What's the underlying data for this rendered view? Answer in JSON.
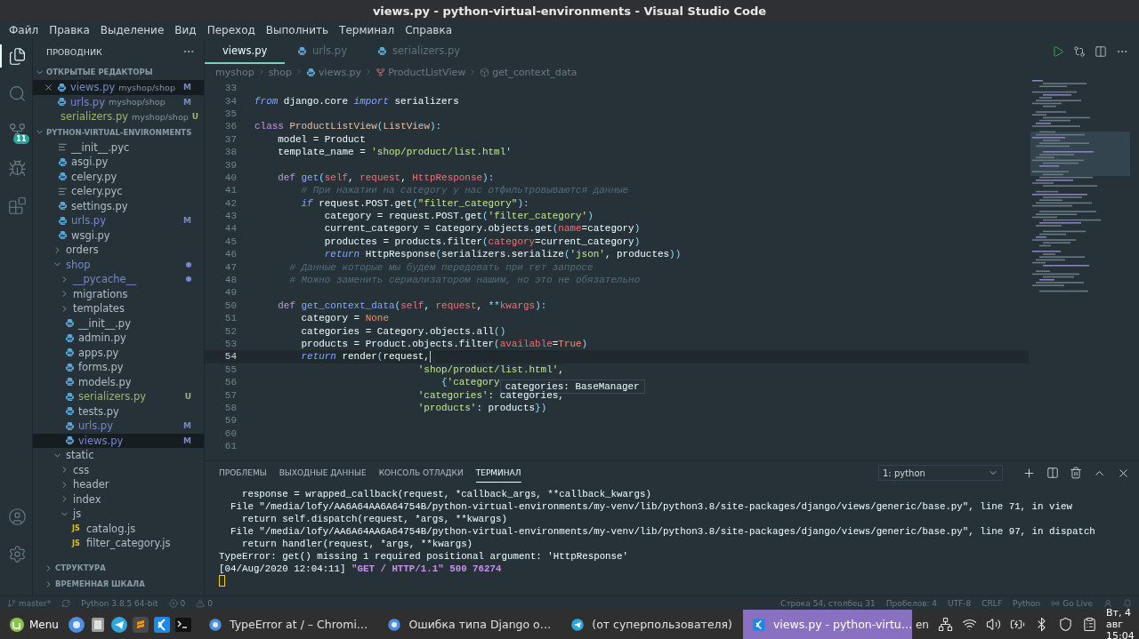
{
  "window": {
    "title": "views.py - python-virtual-environments - Visual Studio Code"
  },
  "menu": [
    "Файл",
    "Правка",
    "Выделение",
    "Вид",
    "Переход",
    "Выполнить",
    "Терминал",
    "Справка"
  ],
  "activity_bar": {
    "items": [
      {
        "kind": "explorer",
        "selected": true
      },
      {
        "kind": "search",
        "selected": false
      },
      {
        "kind": "scm",
        "selected": false,
        "badge": "11"
      },
      {
        "kind": "debug",
        "selected": false
      },
      {
        "kind": "extensions",
        "selected": false
      }
    ],
    "bottom": [
      {
        "kind": "account"
      },
      {
        "kind": "settings"
      }
    ]
  },
  "sidebar": {
    "title": "ПРОВОДНИК",
    "open_editors": {
      "title": "ОТКРЫТЫЕ РЕДАКТОРЫ",
      "expanded": true,
      "items": [
        {
          "name": "views.py",
          "path": "myshop/shop",
          "badge": "M",
          "color": "#7986cb",
          "selected": true
        },
        {
          "name": "urls.py",
          "path": "myshop/shop",
          "badge": "M",
          "color": "#7986cb",
          "selected": false
        },
        {
          "name": "serializers.py",
          "path": "myshop/shop",
          "badge": "U",
          "color": "#9cb46e",
          "selected": false
        }
      ]
    },
    "folder": {
      "title": "PYTHON-VIRTUAL-ENVIRONMENTS",
      "expanded": true,
      "tree": [
        {
          "name": "__init__.pyc",
          "kind": "compiled",
          "selected": false
        },
        {
          "name": "asgi.py",
          "kind": "python",
          "selected": false
        },
        {
          "name": "celery.py",
          "kind": "python",
          "selected": false
        },
        {
          "name": "celery.pyc",
          "kind": "compiled",
          "selected": false
        },
        {
          "name": "settings.py",
          "kind": "python",
          "selected": false
        },
        {
          "name": "urls.py",
          "kind": "python",
          "color": "#7986cb",
          "badge": "M",
          "selected": false
        },
        {
          "name": "wsgi.py",
          "kind": "python",
          "selected": false
        },
        {
          "name": "orders",
          "kind": "folder",
          "expanded": false,
          "selected": false
        },
        {
          "name": "shop",
          "kind": "folder",
          "expanded": true,
          "color": "#7986cb",
          "selected": false,
          "children": [
            {
              "name": "__pycache__",
              "kind": "folder",
              "expanded": false,
              "color": "#7986cb",
              "selected": false
            },
            {
              "name": "migrations",
              "kind": "folder",
              "expanded": false,
              "selected": false
            },
            {
              "name": "templates",
              "kind": "folder",
              "expanded": false,
              "selected": false
            },
            {
              "name": "__init__.py",
              "kind": "python",
              "selected": false
            },
            {
              "name": "admin.py",
              "kind": "python",
              "selected": false
            },
            {
              "name": "apps.py",
              "kind": "python",
              "selected": false
            },
            {
              "name": "forms.py",
              "kind": "python",
              "selected": false
            },
            {
              "name": "models.py",
              "kind": "python",
              "selected": false
            },
            {
              "name": "serializers.py",
              "kind": "python",
              "color": "#9cb46e",
              "badge": "U",
              "selected": false
            },
            {
              "name": "tests.py",
              "kind": "python",
              "selected": false
            },
            {
              "name": "urls.py",
              "kind": "python",
              "color": "#7986cb",
              "badge": "M",
              "selected": false
            },
            {
              "name": "views.py",
              "kind": "python",
              "color": "#7986cb",
              "badge": "M",
              "selected": true
            }
          ]
        },
        {
          "name": "static",
          "kind": "folder",
          "expanded": true,
          "selected": false,
          "children": [
            {
              "name": "css",
              "kind": "folder",
              "expanded": false,
              "selected": false
            },
            {
              "name": "header",
              "kind": "folder",
              "expanded": false,
              "selected": false
            },
            {
              "name": "index",
              "kind": "folder",
              "expanded": false,
              "selected": false
            },
            {
              "name": "js",
              "kind": "folder",
              "expanded": true,
              "selected": false,
              "children": [
                {
                  "name": "catalog.js",
                  "kind": "js",
                  "icon_text": "JS",
                  "selected": false
                },
                {
                  "name": "filter_category.js",
                  "kind": "js",
                  "icon_text": "JS",
                  "selected": false
                }
              ]
            }
          ]
        }
      ]
    },
    "sections": [
      {
        "title": "СТРУКТУРА",
        "expanded": false
      },
      {
        "title": "ВРЕМЕННАЯ ШКАЛА",
        "expanded": false
      }
    ]
  },
  "editor": {
    "tabs": [
      {
        "name": "views.py",
        "selected": true
      },
      {
        "name": "urls.py",
        "selected": false
      },
      {
        "name": "serializers.py",
        "selected": false
      }
    ],
    "breadcrumbs": [
      {
        "kind": "folder",
        "text": "myshop"
      },
      {
        "kind": "folder",
        "text": "shop"
      },
      {
        "kind": "file",
        "text": "views.py"
      },
      {
        "kind": "class",
        "text": "ProductListView"
      },
      {
        "kind": "method",
        "text": "get_context_data"
      }
    ],
    "lines": [
      {
        "number": "33",
        "current": false
      },
      {
        "number": "34",
        "current": false,
        "tokens": [
          {
            "kind": "control",
            "text": "from"
          },
          {
            "kind": "plain",
            "text": " django.core "
          },
          {
            "kind": "control",
            "text": "import"
          },
          {
            "kind": "plain",
            "text": " serializers"
          }
        ]
      },
      {
        "number": "35",
        "current": false
      },
      {
        "number": "36",
        "current": false,
        "tokens": [
          {
            "kind": "keyword",
            "text": "class "
          },
          {
            "kind": "class",
            "text": "ProductListView"
          },
          {
            "kind": "punct",
            "text": "("
          },
          {
            "kind": "class",
            "text": "ListView"
          },
          {
            "kind": "punct",
            "text": "):"
          }
        ]
      },
      {
        "number": "37",
        "current": false,
        "tokens": [
          {
            "kind": "plain",
            "text": "    model = Product"
          }
        ]
      },
      {
        "number": "38",
        "current": false,
        "tokens": [
          {
            "kind": "plain",
            "text": "    template_name = "
          },
          {
            "kind": "string",
            "text": "'shop/product/list.html'"
          }
        ]
      },
      {
        "number": "39",
        "current": false
      },
      {
        "number": "40",
        "current": false,
        "tokens": [
          {
            "kind": "keyword",
            "text": "    def "
          },
          {
            "kind": "func",
            "text": "get"
          },
          {
            "kind": "punct",
            "text": "("
          },
          {
            "kind": "param",
            "text": "self"
          },
          {
            "kind": "plain",
            "text": ", "
          },
          {
            "kind": "param",
            "text": "request"
          },
          {
            "kind": "plain",
            "text": ", "
          },
          {
            "kind": "param",
            "text": "HttpResponse"
          },
          {
            "kind": "punct",
            "text": "):"
          }
        ]
      },
      {
        "number": "41",
        "current": false,
        "tokens": [
          {
            "kind": "comment",
            "text": "        # При нажатии на category у нас отфильтровываются данные"
          }
        ]
      },
      {
        "number": "42",
        "current": false,
        "tokens": [
          {
            "kind": "control",
            "text": "        if"
          },
          {
            "kind": "plain",
            "text": " request.POST.get"
          },
          {
            "kind": "punct",
            "text": "("
          },
          {
            "kind": "string",
            "text": "\"filter_category\""
          },
          {
            "kind": "punct",
            "text": "):"
          }
        ]
      },
      {
        "number": "43",
        "current": false,
        "tokens": [
          {
            "kind": "plain",
            "text": "            category = request.POST.get"
          },
          {
            "kind": "punct",
            "text": "("
          },
          {
            "kind": "string",
            "text": "'filter_category'"
          },
          {
            "kind": "punct",
            "text": ")"
          }
        ]
      },
      {
        "number": "44",
        "current": false,
        "tokens": [
          {
            "kind": "plain",
            "text": "            current_category = Category.objects.get"
          },
          {
            "kind": "punct",
            "text": "("
          },
          {
            "kind": "param",
            "text": "name"
          },
          {
            "kind": "plain",
            "text": "=category"
          },
          {
            "kind": "punct",
            "text": ")"
          }
        ]
      },
      {
        "number": "45",
        "current": false,
        "tokens": [
          {
            "kind": "plain",
            "text": "            productes = products.filter"
          },
          {
            "kind": "punct",
            "text": "("
          },
          {
            "kind": "param",
            "text": "category"
          },
          {
            "kind": "plain",
            "text": "=current_category"
          },
          {
            "kind": "punct",
            "text": ")"
          }
        ]
      },
      {
        "number": "46",
        "current": false,
        "tokens": [
          {
            "kind": "control",
            "text": "            return"
          },
          {
            "kind": "plain",
            "text": " HttpResponse"
          },
          {
            "kind": "punct",
            "text": "("
          },
          {
            "kind": "plain",
            "text": "serializers.serialize"
          },
          {
            "kind": "punct",
            "text": "("
          },
          {
            "kind": "string",
            "text": "'json'"
          },
          {
            "kind": "plain",
            "text": ", productes"
          },
          {
            "kind": "punct",
            "text": "))"
          }
        ]
      },
      {
        "number": "47",
        "current": false,
        "tokens": [
          {
            "kind": "comment",
            "text": "      # Данные которые мы будем передовать при гет запросе"
          }
        ]
      },
      {
        "number": "48",
        "current": false,
        "tokens": [
          {
            "kind": "comment",
            "text": "      # Можно заменить сериализатором нашим, но это не обязательно"
          }
        ]
      },
      {
        "number": "49",
        "current": false
      },
      {
        "number": "50",
        "current": false,
        "tokens": [
          {
            "kind": "keyword",
            "text": "    def "
          },
          {
            "kind": "func",
            "text": "get_context_data"
          },
          {
            "kind": "punct",
            "text": "("
          },
          {
            "kind": "param",
            "text": "self"
          },
          {
            "kind": "plain",
            "text": ", "
          },
          {
            "kind": "param",
            "text": "request"
          },
          {
            "kind": "plain",
            "text": ", "
          },
          {
            "kind": "punct",
            "text": "**"
          },
          {
            "kind": "param",
            "text": "kwargs"
          },
          {
            "kind": "punct",
            "text": "):"
          }
        ]
      },
      {
        "number": "51",
        "current": false,
        "tokens": [
          {
            "kind": "plain",
            "text": "        category = "
          },
          {
            "kind": "const",
            "text": "None"
          }
        ]
      },
      {
        "number": "52",
        "current": false,
        "tokens": [
          {
            "kind": "plain",
            "text": "        categories = Category.objects.all"
          },
          {
            "kind": "punct",
            "text": "()"
          }
        ]
      },
      {
        "number": "53",
        "current": false,
        "tokens": [
          {
            "kind": "plain",
            "text": "        products = Product.objects.filter"
          },
          {
            "kind": "punct",
            "text": "("
          },
          {
            "kind": "param",
            "text": "available"
          },
          {
            "kind": "plain",
            "text": "="
          },
          {
            "kind": "const",
            "text": "True"
          },
          {
            "kind": "punct",
            "text": ")"
          }
        ]
      },
      {
        "number": "54",
        "current": true,
        "tokens": [
          {
            "kind": "control",
            "text": "        return"
          },
          {
            "kind": "plain",
            "text": " render"
          },
          {
            "kind": "punct",
            "text": "("
          },
          {
            "kind": "plain",
            "text": "request,"
          }
        ]
      },
      {
        "number": "55",
        "current": false,
        "tokens": [
          {
            "kind": "string",
            "text": "                            'shop/product/list.html'"
          },
          {
            "kind": "plain",
            "text": ","
          }
        ]
      },
      {
        "number": "56",
        "current": false,
        "tokens": [
          {
            "kind": "punct",
            "text": "                                {"
          },
          {
            "kind": "string",
            "text": "'category"
          }
        ],
        "hover": "categories: BaseManager"
      },
      {
        "number": "57",
        "current": false,
        "tokens": [
          {
            "kind": "string",
            "text": "                            'categories'"
          },
          {
            "kind": "plain",
            "text": ": categories,"
          }
        ]
      },
      {
        "number": "58",
        "current": false,
        "tokens": [
          {
            "kind": "string",
            "text": "                            'products'"
          },
          {
            "kind": "plain",
            "text": ": products"
          },
          {
            "kind": "punct",
            "text": "})"
          }
        ]
      },
      {
        "number": "59",
        "current": false
      },
      {
        "number": "60",
        "current": false
      },
      {
        "number": "61",
        "current": false
      }
    ]
  },
  "panel": {
    "tabs": [
      {
        "label": "ПРОБЛЕМЫ",
        "selected": false
      },
      {
        "label": "ВЫХОДНЫЕ ДАННЫЕ",
        "selected": false
      },
      {
        "label": "КОНСОЛЬ ОТЛАДКИ",
        "selected": false
      },
      {
        "label": "ТЕРМИНАЛ",
        "selected": true
      }
    ],
    "terminal_select": "1: python",
    "lines": [
      [
        {
          "kind": "plain",
          "text": "    response = wrapped_callback(request, *callback_args, **callback_kwargs)"
        }
      ],
      [
        {
          "kind": "plain",
          "text": "  File \"/media/lofy/AA6A64AA6A64754B/python-virtual-environments/my-venv/lib/python3.8/site-packages/django/views/generic/base.py\", line 71, in view"
        }
      ],
      [
        {
          "kind": "plain",
          "text": "    return self.dispatch(request, *args, **kwargs)"
        }
      ],
      [
        {
          "kind": "plain",
          "text": "  File \"/media/lofy/AA6A64AA6A64754B/python-virtual-environments/my-venv/lib/python3.8/site-packages/django/views/generic/base.py\", line 97, in dispatch"
        }
      ],
      [
        {
          "kind": "plain",
          "text": "    return handler(request, *args, **kwargs)"
        }
      ],
      [
        {
          "kind": "plain",
          "text": "TypeError: get() missing 1 required positional argument: 'HttpResponse'"
        }
      ],
      [
        {
          "kind": "plain",
          "text": "[04/Aug/2020 12:04:11] "
        },
        {
          "kind": "highlight",
          "text": "\"GET / HTTP/1.1\" 500 76274"
        }
      ]
    ]
  },
  "status_bar": {
    "left": [
      {
        "kind": "branch",
        "text": "master*"
      },
      {
        "kind": "sync"
      },
      {
        "kind": "text",
        "text": "Python 3.8.5 64-bit"
      },
      {
        "kind": "errors",
        "text": "0"
      },
      {
        "kind": "warnings",
        "text": "0"
      }
    ],
    "right": [
      {
        "kind": "text",
        "text": "Строка 54, столбец 31"
      },
      {
        "kind": "text",
        "text": "Пробелов: 4"
      },
      {
        "kind": "text",
        "text": "UTF-8"
      },
      {
        "kind": "text",
        "text": "CRLF"
      },
      {
        "kind": "text",
        "text": "Python"
      },
      {
        "kind": "live",
        "text": "Go Live"
      },
      {
        "kind": "feedback"
      },
      {
        "kind": "bell"
      }
    ]
  },
  "taskbar": {
    "menu": "Menu",
    "launchers": [
      {
        "kind": "browser"
      },
      {
        "kind": "files"
      },
      {
        "kind": "messenger"
      },
      {
        "kind": "editor"
      },
      {
        "kind": "code"
      },
      {
        "kind": "terminal"
      }
    ],
    "windows": [
      {
        "kind": "browser",
        "title": "TypeError at / – Chromi…",
        "selected": false
      },
      {
        "kind": "browser",
        "title": "Ошибка типа Django о…",
        "selected": false
      },
      {
        "kind": "messenger",
        "title": "(от суперпользователя)",
        "selected": false
      },
      {
        "kind": "code",
        "title": "views.py - python-virtu…",
        "selected": true
      }
    ],
    "language": "en",
    "tray": [
      {
        "kind": "network"
      },
      {
        "kind": "wifi"
      },
      {
        "kind": "volume"
      },
      {
        "kind": "power"
      },
      {
        "kind": "bluetooth"
      },
      {
        "kind": "shield"
      },
      {
        "kind": "clipboard"
      }
    ],
    "date": "Вт, 4 авг",
    "time": "15:04"
  }
}
